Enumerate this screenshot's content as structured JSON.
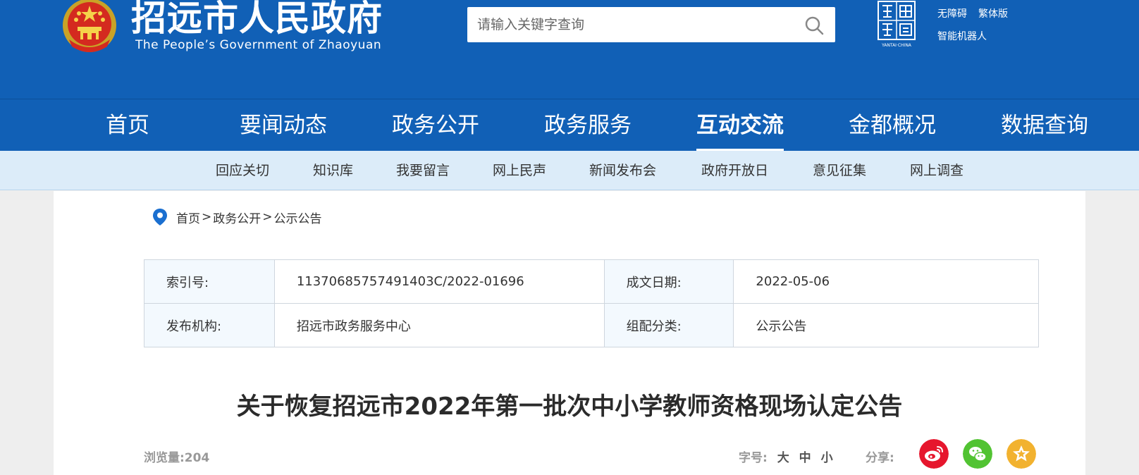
{
  "header": {
    "title": "招远市人民政府",
    "subtitle": "The People’s Government of Zhaoyuan",
    "search_placeholder": "请输入关键字查询",
    "seal_caption": "YANTAI·CHINA",
    "tools": [
      "无障碍",
      "繁体版",
      "智能机器人"
    ]
  },
  "nav": {
    "items": [
      "首页",
      "要闻动态",
      "政务公开",
      "政务服务",
      "互动交流",
      "金都概况",
      "数据查询"
    ],
    "active": "互动交流"
  },
  "subnav": {
    "items": [
      "回应关切",
      "知识库",
      "我要留言",
      "网上民声",
      "新闻发布会",
      "政府开放日",
      "意见征集",
      "网上调查"
    ]
  },
  "breadcrumb": {
    "items": [
      "首页",
      "政务公开",
      "公示公告"
    ],
    "separator": ">"
  },
  "meta": {
    "index_label": "索引号:",
    "index_value": "11370685757491403C/2022-01696",
    "date_label": "成文日期:",
    "date_value": "2022-05-06",
    "org_label": "发布机构:",
    "org_value": "招远市政务服务中心",
    "category_label": "组配分类:",
    "category_value": "公示公告"
  },
  "article": {
    "title": "关于恢复招远市2022年第一批次中小学教师资格现场认定公告",
    "views": "浏览量:204",
    "font_label": "字号:",
    "font_sizes": [
      "大",
      "中",
      "小"
    ],
    "share_label": "分享:"
  },
  "colors": {
    "header_blue": "#1160b6",
    "subnav_bg": "#dcecf9",
    "weibo": "#e6162d",
    "wechat": "#51c332",
    "favorite": "#f2b22f"
  },
  "icons": {
    "search": "search-icon",
    "location": "location-pin-icon",
    "weibo": "weibo-icon",
    "wechat": "wechat-icon",
    "favorite": "star-icon"
  }
}
